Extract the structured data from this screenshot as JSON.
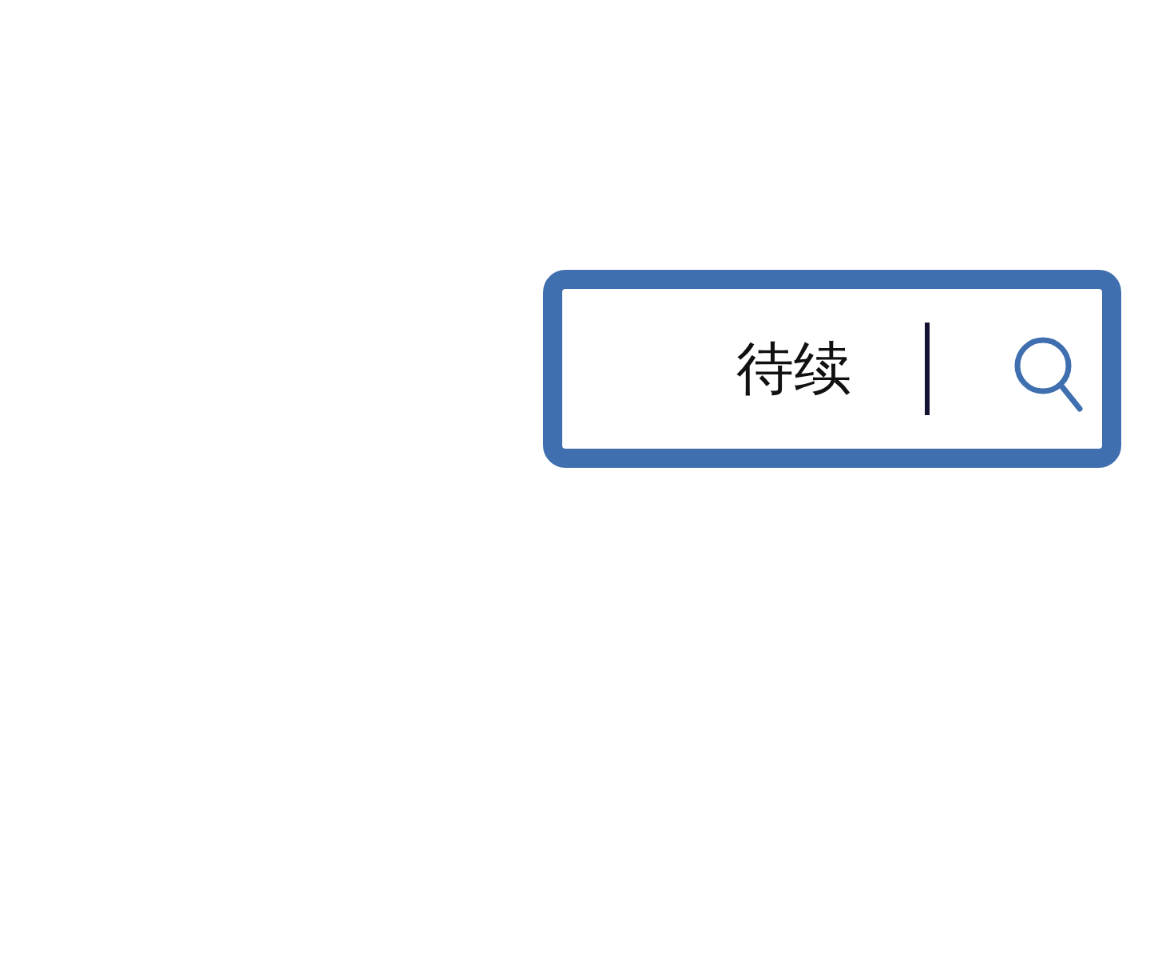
{
  "search": {
    "value": "待续",
    "focused": true
  }
}
